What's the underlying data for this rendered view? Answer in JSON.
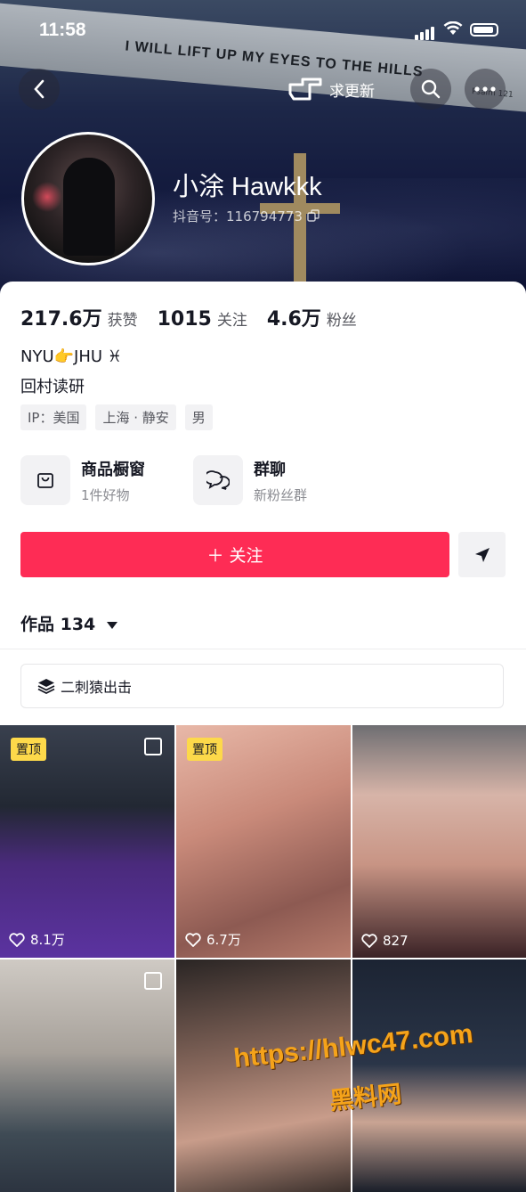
{
  "status_bar": {
    "time": "11:58"
  },
  "header": {
    "banner_text": "I WILL LIFT UP MY EYES TO THE HILLS",
    "banner_ref": "Psalm 121",
    "request_update_label": "求更新"
  },
  "profile": {
    "name": "小涂 Hawkkk",
    "douyin_id": "抖音号：116794773"
  },
  "stats": [
    {
      "value": "217.6万",
      "label": "获赞"
    },
    {
      "value": "1015",
      "label": "关注"
    },
    {
      "value": "4.6万",
      "label": "粉丝"
    }
  ],
  "bio": {
    "line1": "NYU👉JHU ♓",
    "line2": "回村读研"
  },
  "tags": [
    "IP：美国",
    "上海 · 静安",
    "男"
  ],
  "services": [
    {
      "title": "商品橱窗",
      "subtitle": "1件好物",
      "icon": "bag-icon"
    },
    {
      "title": "群聊",
      "subtitle": "新粉丝群",
      "icon": "chat-icon"
    }
  ],
  "actions": {
    "follow_label": "＋ 关注"
  },
  "works": {
    "label": "作品 134"
  },
  "collection": {
    "label": "二刺猿出击"
  },
  "videos": [
    {
      "pinned": "置顶",
      "likes": "8.1万",
      "multi": true
    },
    {
      "pinned": "置顶",
      "likes": "6.7万",
      "multi": false
    },
    {
      "pinned": "",
      "likes": "827",
      "multi": false
    },
    {
      "pinned": "",
      "likes": "",
      "multi": true
    },
    {
      "pinned": "",
      "likes": "",
      "multi": false
    },
    {
      "pinned": "",
      "likes": "",
      "multi": false
    }
  ],
  "watermark": {
    "url": "https://hlwc47.com",
    "text": "黑料网"
  },
  "colors": {
    "accent": "#fe2c55",
    "pin": "#fdd94a"
  }
}
